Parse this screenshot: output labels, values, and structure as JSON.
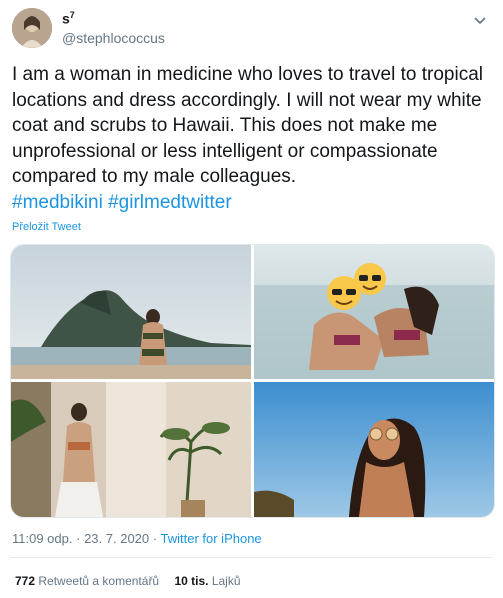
{
  "user": {
    "display_name": "s",
    "display_name_sup": "7",
    "handle": "@stephlococcus"
  },
  "tweet": {
    "text": "I am a woman in medicine who loves to travel to tropical locations and dress accordingly. I will not wear my white coat and scrubs to Hawaii. This does not make me unprofessional or less intelligent or compassionate compared to my male colleagues.",
    "hashtags": [
      "#medbikini",
      "#girlmedtwitter"
    ],
    "translate_label": "Přeložit Tweet"
  },
  "meta": {
    "time": "11:09 odp.",
    "separator": "·",
    "date": "23. 7. 2020",
    "source": "Twitter for iPhone"
  },
  "stats": {
    "retweets_count": "772",
    "retweets_label": "Retweetů a komentářů",
    "likes_count": "10 tis.",
    "likes_label": "Lajků"
  },
  "icons": {
    "more": "chevron-down-icon"
  }
}
